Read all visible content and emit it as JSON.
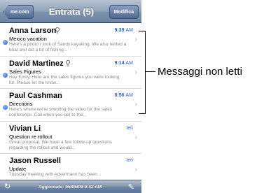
{
  "navbar": {
    "back_label": "me.com",
    "title": "Entrata (5)",
    "edit_label": "Modifica"
  },
  "messages": [
    {
      "sender": "Anna Larson",
      "unread": true,
      "attachment": true,
      "time": "9:39",
      "ampm": "AM",
      "subject": "Mexico vacation",
      "preview": "Here's a photo I took of Sandy kayaking. We also rented a boat and did a bit of fishing..."
    },
    {
      "sender": "David Martinez",
      "unread": true,
      "attachment": true,
      "time": "9:14",
      "ampm": "AM",
      "subject": "Sales Figures",
      "preview": "Hey Emily, Here are the sales figures you were looking for. Please let me know..."
    },
    {
      "sender": "Paul Cashman",
      "unread": true,
      "attachment": false,
      "time": "8:56",
      "ampm": "AM",
      "subject": "Directions",
      "preview": "Here's where we're shooting the video for the sales conference. Call when you get to the..."
    },
    {
      "sender": "Vivian Li",
      "unread": false,
      "attachment": false,
      "time": "Ieri",
      "ampm": "",
      "subject": "Question re rollout",
      "preview": "Great proposal. We have a few follow-up questions regarding the rollout and would..."
    },
    {
      "sender": "Jason Russell",
      "unread": false,
      "attachment": false,
      "time": "Ieri",
      "ampm": "",
      "subject": "Update",
      "preview": "Tuesday meeting with Ackermann has been..."
    }
  ],
  "toolbar": {
    "refresh_icon": "refresh-icon",
    "updated_text": "Aggiornato: 05/06/09 9:42 AM",
    "compose_icon": "compose-icon"
  },
  "callout": {
    "label": "Messaggi non letti"
  },
  "colors": {
    "unread_dot": "#1f5fd0",
    "time_blue": "#2a62c9",
    "bar_blue": "#7d92ad"
  }
}
